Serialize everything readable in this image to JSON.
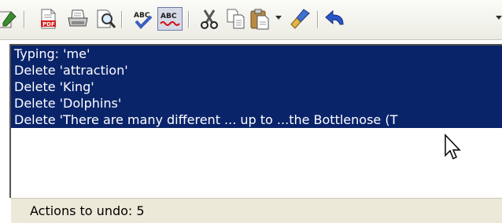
{
  "toolbar": {
    "buttons": [
      {
        "icon": "pencil-icon"
      },
      {
        "icon": "pdf-export-icon"
      },
      {
        "icon": "print-icon"
      },
      {
        "icon": "print-preview-icon"
      },
      {
        "icon": "spellcheck-icon"
      },
      {
        "icon": "autospellcheck-icon"
      },
      {
        "icon": "cut-icon"
      },
      {
        "icon": "copy-icon"
      },
      {
        "icon": "paste-icon"
      },
      {
        "icon": "clone-formatting-icon"
      },
      {
        "icon": "undo-icon"
      }
    ]
  },
  "undo_list": {
    "items": [
      {
        "label": "Typing: 'me'"
      },
      {
        "label": "Delete 'attraction'"
      },
      {
        "label": "Delete 'King'"
      },
      {
        "label": "Delete 'Dolphins'"
      },
      {
        "label": "Delete 'There are many different ... up to ...the Bottlenose (T"
      }
    ],
    "selected_count": 5
  },
  "status": {
    "label": "Actions to undo: 5"
  },
  "colors": {
    "selection": "#0a246a",
    "selection_text": "#ffffff",
    "toolbar_bg": "#ecebe3",
    "status_bg": "#ece9d8"
  }
}
